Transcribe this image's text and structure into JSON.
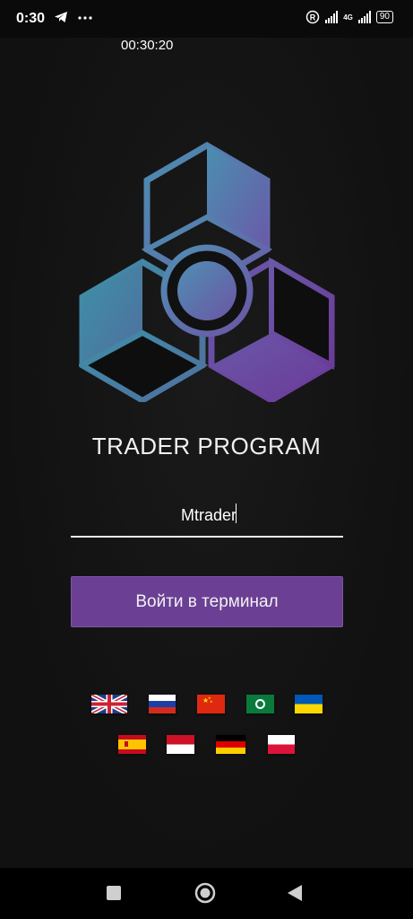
{
  "status_bar": {
    "time": "0:30",
    "battery": "90",
    "network": "4G",
    "icons": [
      "telegram-icon",
      "more-dots-icon",
      "registered-icon",
      "signal-icon",
      "signal-4g-icon",
      "battery-icon"
    ]
  },
  "overlay_timer": "00:30:20",
  "app": {
    "title": "TRADER PROGRAM",
    "login_value": "Mtrader",
    "enter_button": "Войти в терминал",
    "colors": {
      "accent": "#6a3f94",
      "logo_teal": "#5fa3b8",
      "logo_purple": "#6b3f99"
    }
  },
  "languages": [
    {
      "name": "flag-uk-icon",
      "lang": "English"
    },
    {
      "name": "flag-ru-icon",
      "lang": "Russian"
    },
    {
      "name": "flag-cn-icon",
      "lang": "Chinese"
    },
    {
      "name": "flag-arab-icon",
      "lang": "Arabic"
    },
    {
      "name": "flag-ua-icon",
      "lang": "Ukrainian"
    },
    {
      "name": "flag-es-icon",
      "lang": "Spanish"
    },
    {
      "name": "flag-id-icon",
      "lang": "Indonesian"
    },
    {
      "name": "flag-de-icon",
      "lang": "German"
    },
    {
      "name": "flag-pl-icon",
      "lang": "Polish"
    }
  ],
  "navigation": [
    "recents-square-icon",
    "home-circle-icon",
    "back-triangle-icon"
  ]
}
